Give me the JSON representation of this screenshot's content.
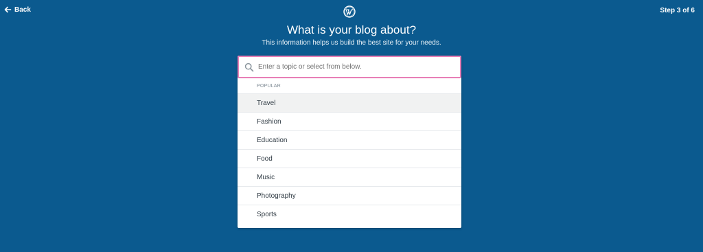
{
  "header": {
    "back_label": "Back",
    "step_label": "Step 3 of 6"
  },
  "page": {
    "title": "What is your blog about?",
    "subtitle": "This information helps us build the best site for your needs."
  },
  "search": {
    "placeholder": "Enter a topic or select from below."
  },
  "suggestions": {
    "section_label": "POPULAR",
    "items": [
      {
        "label": "Travel"
      },
      {
        "label": "Fashion"
      },
      {
        "label": "Education"
      },
      {
        "label": "Food"
      },
      {
        "label": "Music"
      },
      {
        "label": "Photography"
      },
      {
        "label": "Sports"
      }
    ]
  },
  "colors": {
    "background": "#0b5a8f",
    "search_focus_border": "#e87fb6",
    "highlight": "#f1f2f2"
  },
  "icons": {
    "back": "arrow-left-icon",
    "logo": "wordpress-logo-icon",
    "search": "search-icon"
  }
}
